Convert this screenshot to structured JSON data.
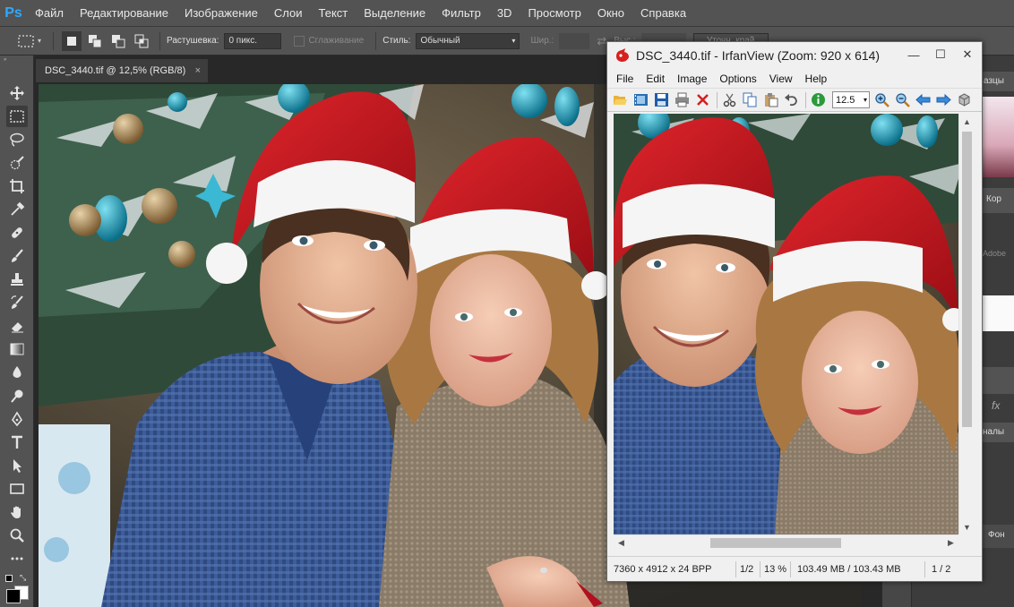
{
  "app": {
    "logo": "Ps",
    "menu": [
      "Файл",
      "Редактирование",
      "Изображение",
      "Слои",
      "Текст",
      "Выделение",
      "Фильтр",
      "3D",
      "Просмотр",
      "Окно",
      "Справка"
    ]
  },
  "options_bar": {
    "feather_label": "Растушевка:",
    "feather_value": "0 пикс.",
    "antialias_label": "Сглаживание",
    "style_label": "Стиль:",
    "style_value": "Обычный",
    "width_label": "Шир.:",
    "height_label": "Выс.:",
    "refine_button": "Уточн. край"
  },
  "document": {
    "tab_title": "DSC_3440.tif @ 12,5% (RGB/8)",
    "close_glyph": "×"
  },
  "tools": [
    "move-icon",
    "marquee-icon",
    "lasso-icon",
    "quick-select-icon",
    "crop-icon",
    "eyedropper-icon",
    "healing-icon",
    "brush-icon",
    "stamp-icon",
    "history-brush-icon",
    "eraser-icon",
    "gradient-icon",
    "blur-icon",
    "dodge-icon",
    "pen-icon",
    "type-icon",
    "path-select-icon",
    "rectangle-icon",
    "hand-icon",
    "zoom-icon",
    "more-icon"
  ],
  "right_panel": {
    "swatches_tab": "азцы",
    "adjust_label": "Кор",
    "adobe_label": "Adobe",
    "channels_tab": "налы",
    "layer_label": "Фон",
    "fx_label": "fx"
  },
  "irfanview": {
    "title": "DSC_3440.tif - IrfanView (Zoom: 920 x 614)",
    "menu": [
      "File",
      "Edit",
      "Image",
      "Options",
      "View",
      "Help"
    ],
    "zoom_value": "12.5",
    "status": {
      "dimensions": "7360 x 4912 x 24 BPP",
      "page": "1/2",
      "zoom": "13 %",
      "memory": "103.49 MB / 103.43 MB",
      "index": "1 / 2"
    },
    "toolbar_icons": [
      "open-icon",
      "filmstrip-icon",
      "save-icon",
      "print-icon",
      "delete-icon",
      "cut-icon",
      "copy-icon",
      "paste-icon",
      "undo-icon",
      "info-icon",
      "zoom-in-icon",
      "zoom-out-icon",
      "prev-icon",
      "next-icon",
      "settings-icon"
    ]
  },
  "colors": {
    "ps_panel": "#535353",
    "ps_canvas": "#282828",
    "accent": "#31a8ff",
    "hat_red": "#c8141c",
    "shirt_blue": "#3d5d9a",
    "sweater": "#8a7a68"
  }
}
